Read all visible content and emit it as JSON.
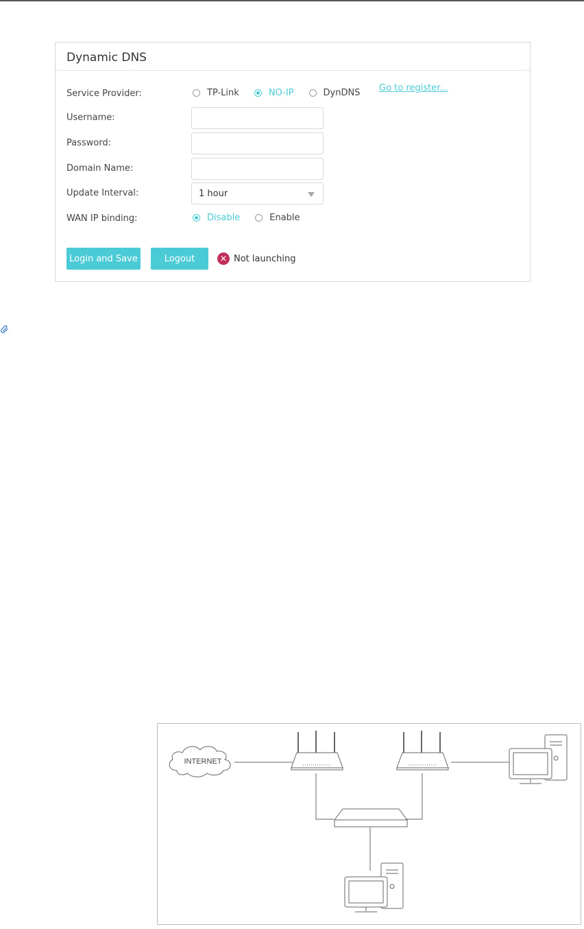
{
  "panel": {
    "title": "Dynamic DNS",
    "service_provider": {
      "label": "Service Provider:",
      "options": [
        "TP-Link",
        "NO-IP",
        "DynDNS"
      ],
      "selected": "NO-IP",
      "register_link": "Go to register..."
    },
    "username": {
      "label": "Username:",
      "value": ""
    },
    "password": {
      "label": "Password:",
      "value": ""
    },
    "domain_name": {
      "label": "Domain Name:",
      "value": ""
    },
    "update_interval": {
      "label": "Update Interval:",
      "value": "1 hour"
    },
    "wan_ip_binding": {
      "label": "WAN IP binding:",
      "options": [
        "Disable",
        "Enable"
      ],
      "selected": "Disable"
    },
    "buttons": {
      "login_save": "Login and Save",
      "logout": "Logout"
    },
    "status": {
      "text": "Not launching",
      "icon": "error-x-icon"
    }
  },
  "diagram": {
    "internet_label": "INTERNET"
  },
  "colors": {
    "accent": "#4acbd6",
    "error": "#c0305a",
    "border": "#d8d8d8"
  }
}
